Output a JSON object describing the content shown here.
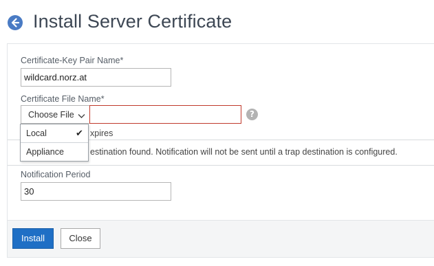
{
  "header": {
    "title": "Install Server Certificate",
    "back_icon": "back-arrow-icon"
  },
  "form": {
    "cert_key_pair": {
      "label": "Certificate-Key Pair Name*",
      "value": "wildcard.norz.at"
    },
    "cert_file": {
      "label": "Certificate File Name*",
      "choose_label": "Choose File",
      "value": "",
      "help_glyph": "?"
    },
    "notify_text_partial": "xpires",
    "trap_text_partial": "estination found. Notification will not be sent until a trap destination is configured.",
    "notification_period": {
      "label": "Notification Period",
      "value": "30"
    }
  },
  "dropdown": {
    "items": [
      {
        "label": "Local",
        "selected": true,
        "check": "✔"
      },
      {
        "label": "Appliance",
        "selected": false
      }
    ]
  },
  "footer": {
    "install_label": "Install",
    "close_label": "Close"
  },
  "colors": {
    "accent": "#1f6fc5",
    "error_border": "#c0392b",
    "title": "#3d4754"
  }
}
